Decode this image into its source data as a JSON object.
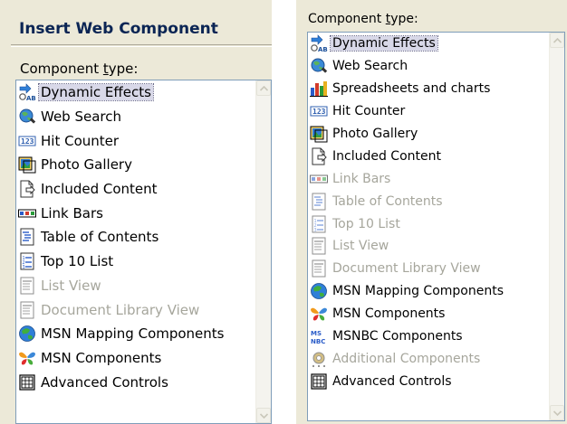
{
  "left": {
    "title": "Insert Web Component",
    "label_prefix": "Component ",
    "label_accel": "t",
    "label_suffix": "ype:",
    "items": [
      {
        "label": "Dynamic Effects",
        "icon": "dynamic-effects-icon",
        "state": "selected"
      },
      {
        "label": "Web Search",
        "icon": "web-search-icon",
        "state": "enabled"
      },
      {
        "label": "Hit Counter",
        "icon": "hit-counter-icon",
        "state": "enabled"
      },
      {
        "label": "Photo Gallery",
        "icon": "photo-gallery-icon",
        "state": "enabled"
      },
      {
        "label": "Included Content",
        "icon": "included-content-icon",
        "state": "enabled"
      },
      {
        "label": "Link Bars",
        "icon": "link-bars-icon",
        "state": "enabled"
      },
      {
        "label": "Table of Contents",
        "icon": "table-of-contents-icon",
        "state": "enabled"
      },
      {
        "label": "Top 10 List",
        "icon": "top-10-list-icon",
        "state": "enabled"
      },
      {
        "label": "List View",
        "icon": "list-view-icon",
        "state": "disabled"
      },
      {
        "label": "Document Library View",
        "icon": "document-library-view-icon",
        "state": "disabled"
      },
      {
        "label": "MSN Mapping Components",
        "icon": "msn-mapping-icon",
        "state": "enabled"
      },
      {
        "label": "MSN Components",
        "icon": "msn-butterfly-icon",
        "state": "enabled"
      },
      {
        "label": "Advanced Controls",
        "icon": "advanced-controls-icon",
        "state": "enabled"
      }
    ]
  },
  "right": {
    "label_prefix": "Component ",
    "label_accel": "t",
    "label_suffix": "ype:",
    "items": [
      {
        "label": "Dynamic Effects",
        "icon": "dynamic-effects-icon",
        "state": "selected"
      },
      {
        "label": "Web Search",
        "icon": "web-search-icon",
        "state": "enabled"
      },
      {
        "label": "Spreadsheets and charts",
        "icon": "spreadsheets-charts-icon",
        "state": "enabled"
      },
      {
        "label": "Hit Counter",
        "icon": "hit-counter-icon",
        "state": "enabled"
      },
      {
        "label": "Photo Gallery",
        "icon": "photo-gallery-icon",
        "state": "enabled"
      },
      {
        "label": "Included Content",
        "icon": "included-content-icon",
        "state": "enabled"
      },
      {
        "label": "Link Bars",
        "icon": "link-bars-icon",
        "state": "disabled"
      },
      {
        "label": "Table of Contents",
        "icon": "table-of-contents-icon",
        "state": "disabled"
      },
      {
        "label": "Top 10 List",
        "icon": "top-10-list-icon",
        "state": "disabled"
      },
      {
        "label": "List View",
        "icon": "list-view-icon",
        "state": "disabled"
      },
      {
        "label": "Document Library View",
        "icon": "document-library-view-icon",
        "state": "disabled"
      },
      {
        "label": "MSN Mapping Components",
        "icon": "msn-mapping-icon",
        "state": "enabled"
      },
      {
        "label": "MSN Components",
        "icon": "msn-butterfly-icon",
        "state": "enabled"
      },
      {
        "label": "MSNBC Components",
        "icon": "msnbc-icon",
        "state": "enabled"
      },
      {
        "label": "Additional Components",
        "icon": "additional-components-icon",
        "state": "disabled"
      },
      {
        "label": "Advanced Controls",
        "icon": "advanced-controls-icon",
        "state": "enabled"
      }
    ]
  }
}
